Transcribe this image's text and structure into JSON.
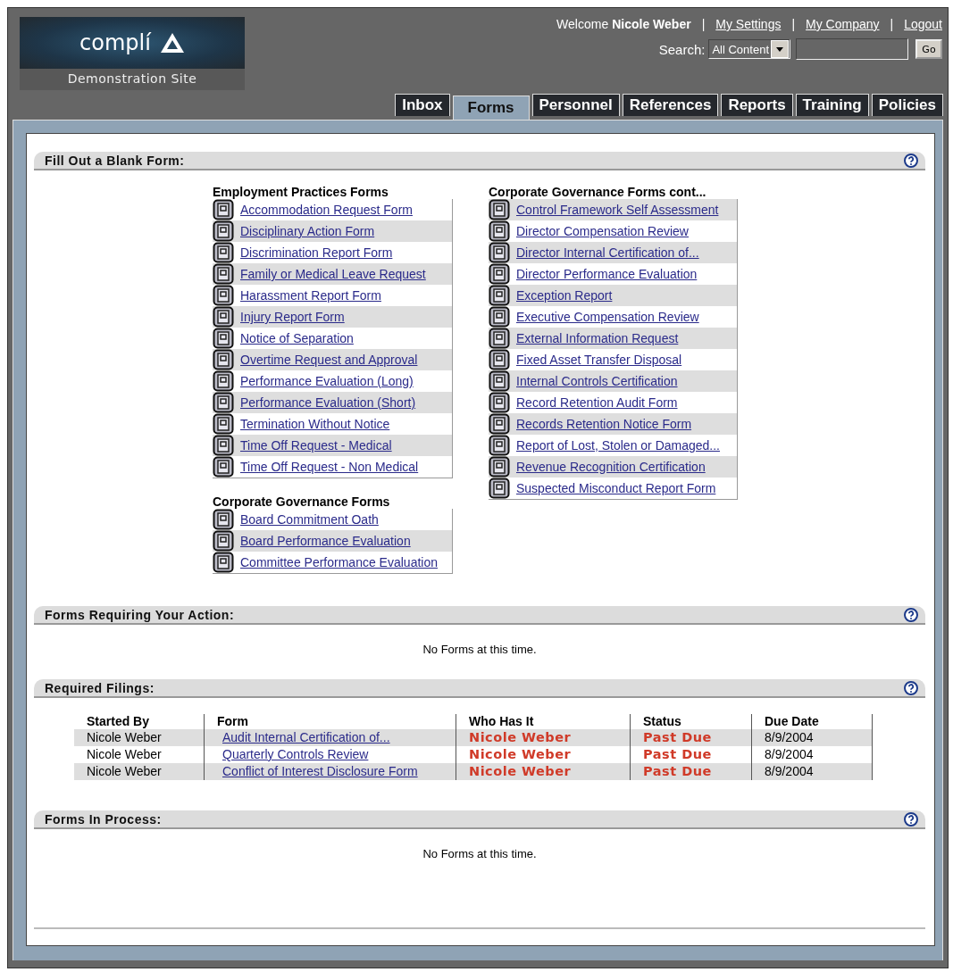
{
  "logo": {
    "wordmark": "complí",
    "subtitle": "Demonstration Site"
  },
  "user_bar": {
    "welcome": "Welcome",
    "user_name": "Nicole Weber",
    "links": [
      "My Settings",
      "My Company",
      "Logout"
    ],
    "separator": "|"
  },
  "search": {
    "label": "Search:",
    "scope": "All Content",
    "button": "Go"
  },
  "tabs": [
    {
      "label": "Inbox",
      "selected": false
    },
    {
      "label": "Forms",
      "selected": true
    },
    {
      "label": "Personnel",
      "selected": false
    },
    {
      "label": "References",
      "selected": false
    },
    {
      "label": "Reports",
      "selected": false
    },
    {
      "label": "Training",
      "selected": false
    },
    {
      "label": "Policies",
      "selected": false
    }
  ],
  "blank_forms": {
    "title": "Fill Out a Blank Form:",
    "columns": [
      [
        {
          "heading": "Employment Practices Forms",
          "items": [
            {
              "label": "Accommodation Request Form",
              "shaded": false
            },
            {
              "label": "Disciplinary Action Form",
              "shaded": true
            },
            {
              "label": "Discrimination Report Form",
              "shaded": false
            },
            {
              "label": "Family or Medical Leave Request",
              "shaded": true
            },
            {
              "label": "Harassment Report Form",
              "shaded": false
            },
            {
              "label": "Injury Report Form",
              "shaded": true
            },
            {
              "label": "Notice of Separation",
              "shaded": false
            },
            {
              "label": "Overtime Request and Approval",
              "shaded": true
            },
            {
              "label": "Performance Evaluation (Long)",
              "shaded": false
            },
            {
              "label": "Performance Evaluation (Short)",
              "shaded": true
            },
            {
              "label": "Termination Without Notice",
              "shaded": false
            },
            {
              "label": "Time Off Request - Medical",
              "shaded": true
            },
            {
              "label": "Time Off Request - Non Medical",
              "shaded": false
            }
          ]
        },
        {
          "heading": "Corporate Governance Forms",
          "items": [
            {
              "label": "Board Commitment Oath",
              "shaded": false
            },
            {
              "label": "Board Performance Evaluation",
              "shaded": true
            },
            {
              "label": "Committee Performance Evaluation",
              "shaded": false
            }
          ]
        }
      ],
      [
        {
          "heading": "Corporate Governance Forms cont...",
          "items": [
            {
              "label": "Control Framework Self Assessment",
              "shaded": true
            },
            {
              "label": "Director Compensation Review",
              "shaded": false
            },
            {
              "label": "Director Internal Certification of...",
              "shaded": true
            },
            {
              "label": "Director Performance Evaluation",
              "shaded": false
            },
            {
              "label": "Exception Report",
              "shaded": true
            },
            {
              "label": "Executive Compensation Review",
              "shaded": false
            },
            {
              "label": "External Information Request",
              "shaded": true
            },
            {
              "label": "Fixed Asset Transfer Disposal",
              "shaded": false
            },
            {
              "label": "Internal Controls Certification",
              "shaded": true
            },
            {
              "label": "Record Retention Audit Form",
              "shaded": false
            },
            {
              "label": "Records Retention Notice Form",
              "shaded": true
            },
            {
              "label": "Report of Lost, Stolen or Damaged...",
              "shaded": false
            },
            {
              "label": "Revenue Recognition Certification",
              "shaded": true
            },
            {
              "label": "Suspected Misconduct Report Form",
              "shaded": false
            }
          ]
        }
      ]
    ]
  },
  "action_forms": {
    "title": "Forms Requiring Your Action:",
    "empty_message": "No Forms at this time."
  },
  "required_filings": {
    "title": "Required Filings:",
    "columns": [
      "Started By",
      "Form",
      "Who Has It",
      "Status",
      "Due Date"
    ],
    "rows": [
      {
        "started_by": "Nicole Weber",
        "form": "Audit Internal Certification of...",
        "who_has_it": "Nicole Weber",
        "status": "Past Due",
        "due_date": "8/9/2004"
      },
      {
        "started_by": "Nicole Weber",
        "form": "Quarterly Controls Review",
        "who_has_it": "Nicole Weber",
        "status": "Past Due",
        "due_date": "8/9/2004"
      },
      {
        "started_by": "Nicole Weber",
        "form": "Conflict of Interest Disclosure Form",
        "who_has_it": "Nicole Weber",
        "status": "Past Due",
        "due_date": "8/9/2004"
      }
    ]
  },
  "in_process": {
    "title": "Forms In Process:",
    "empty_message": "No Forms at this time."
  }
}
